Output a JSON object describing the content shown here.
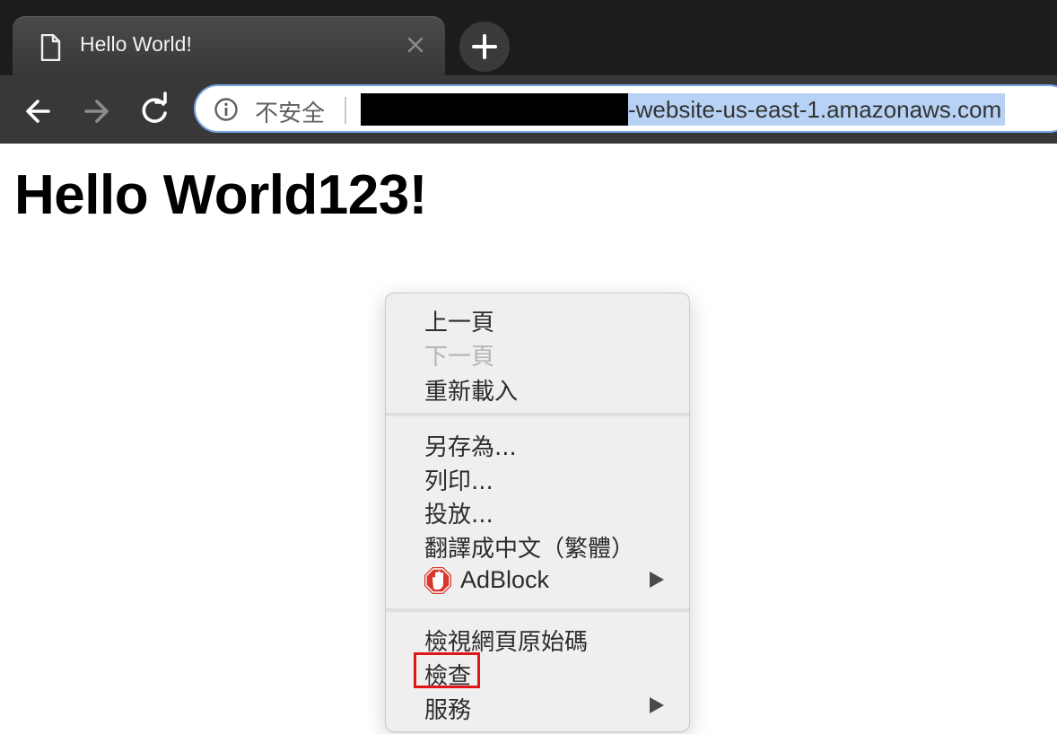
{
  "tab": {
    "title": "Hello World!",
    "icon": "document-icon",
    "close_icon": "close-icon"
  },
  "toolbar": {
    "back_icon": "back-arrow-icon",
    "forward_icon": "forward-arrow-icon",
    "reload_icon": "reload-icon",
    "new_tab_icon": "plus-icon"
  },
  "omnibox": {
    "security_icon": "info-icon",
    "security_label": "不安全",
    "url_visible": "-website-us-east-1.amazonaws.com",
    "highlight_color": "#b7d2f4"
  },
  "page": {
    "heading": "Hello World123!"
  },
  "context_menu": {
    "items": [
      {
        "label": "上一頁",
        "enabled": true
      },
      {
        "label": "下一頁",
        "enabled": false
      },
      {
        "label": "重新載入",
        "enabled": true
      },
      {
        "label": "另存為...",
        "enabled": true
      },
      {
        "label": "列印...",
        "enabled": true
      },
      {
        "label": "投放...",
        "enabled": true
      },
      {
        "label": "翻譯成中文（繁體）",
        "enabled": true
      },
      {
        "label": "AdBlock",
        "enabled": true,
        "icon": "adblock-icon",
        "submenu": true
      },
      {
        "label": "檢視網頁原始碼",
        "enabled": true
      },
      {
        "label": "檢查",
        "enabled": true,
        "highlighted": true
      },
      {
        "label": "服務",
        "enabled": true,
        "submenu": true
      }
    ],
    "highlight_color": "#e0161b"
  }
}
